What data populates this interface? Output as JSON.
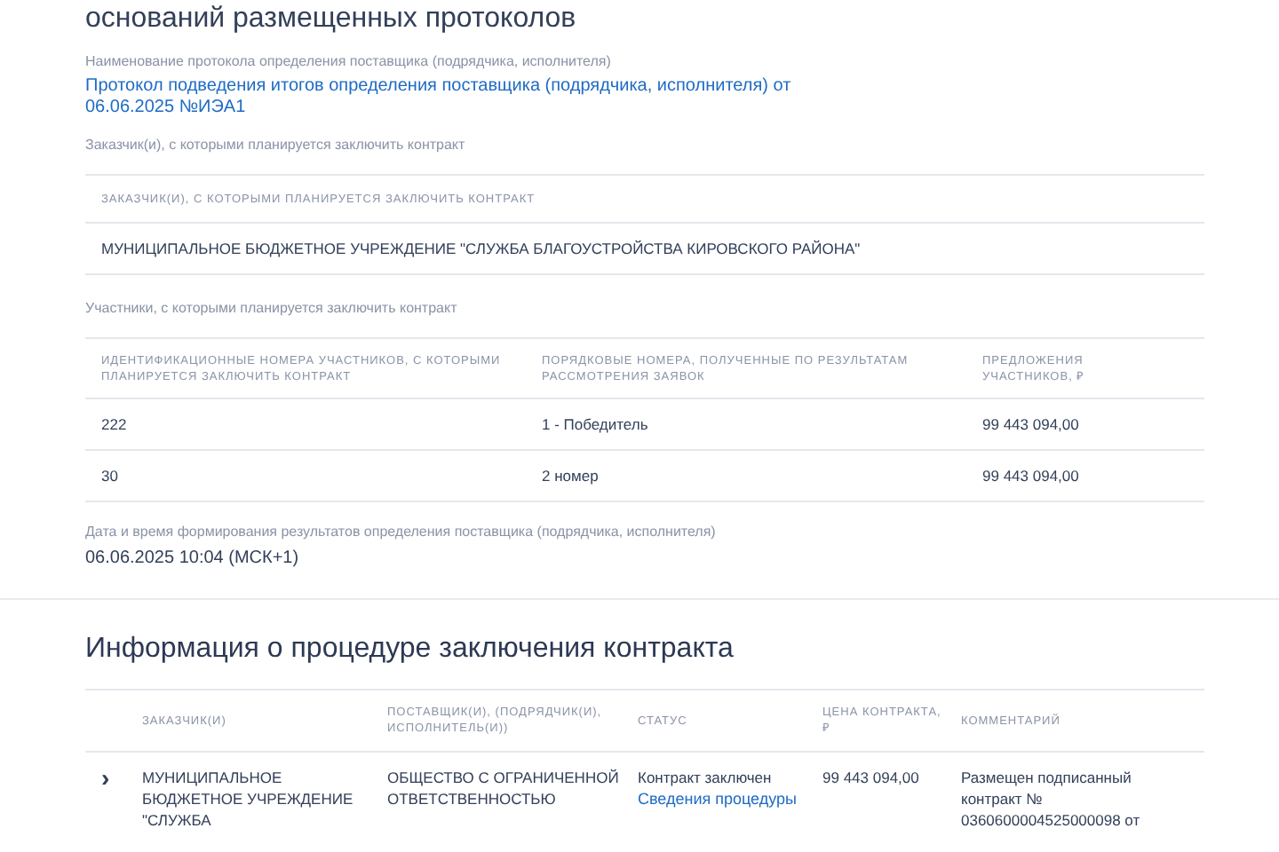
{
  "section_title": "оснований размещенных протоколов",
  "protocol": {
    "label": "Наименование протокола определения поставщика (подрядчика, исполнителя)",
    "link": "Протокол подведения итогов определения поставщика (подрядчика, исполнителя) от 06.06.2025 №ИЭА1"
  },
  "customers_label": "Заказчик(и), с которыми планируется заключить контракт",
  "customers_table": {
    "header": "ЗАКАЗЧИК(И), С КОТОРЫМИ ПЛАНИРУЕТСЯ ЗАКЛЮЧИТЬ КОНТРАКТ",
    "rows": [
      "МУНИЦИПАЛЬНОЕ БЮДЖЕТНОЕ УЧРЕЖДЕНИЕ \"СЛУЖБА БЛАГОУСТРОЙСТВА КИРОВСКОГО РАЙОНА\""
    ]
  },
  "participants_label": "Участники, с которыми планируется заключить контракт",
  "participants_table": {
    "columns": [
      "ИДЕНТИФИКАЦИОННЫЕ НОМЕРА УЧАСТНИКОВ, С КОТОРЫМИ ПЛАНИРУЕТСЯ ЗАКЛЮЧИТЬ КОНТРАКТ",
      "ПОРЯДКОВЫЕ НОМЕРА, ПОЛУЧЕННЫЕ ПО РЕЗУЛЬТАТАМ РАССМОТРЕНИЯ ЗАЯВОК",
      "ПРЕДЛОЖЕНИЯ УЧАСТНИКОВ, ₽"
    ],
    "rows": [
      [
        "222",
        "1 - Победитель",
        "99 443 094,00"
      ],
      [
        "30",
        "2 номер",
        "99 443 094,00"
      ]
    ]
  },
  "datetime": {
    "label": "Дата и время формирования результатов определения поставщика (подрядчика, исполнителя)",
    "value": "06.06.2025 10:04 (МСК+1)"
  },
  "contract_section": {
    "title": "Информация о процедуре заключения контракта",
    "columns": [
      "ЗАКАЗЧИК(И)",
      "ПОСТАВЩИК(И), (ПОДРЯДЧИК(И), ИСПОЛНИТЕЛЬ(И))",
      "СТАТУС",
      "ЦЕНА КОНТРАКТА, ₽",
      "КОММЕНТАРИЙ"
    ],
    "rows": [
      {
        "expanded": false,
        "toggle": "›",
        "customer": "МУНИЦИПАЛЬНОЕ БЮДЖЕТНОЕ УЧРЕЖДЕНИЕ \"СЛУЖБА",
        "supplier": "ОБЩЕСТВО С ОГРАНИЧЕННОЙ ОТВЕТСТВЕННОСТЬЮ",
        "status": "Контракт заключен",
        "status_link": "Сведения процедуры",
        "price": "99 443 094,00",
        "comment": "Размещен подписанный контракт № 0360600004525000098 от"
      }
    ]
  }
}
